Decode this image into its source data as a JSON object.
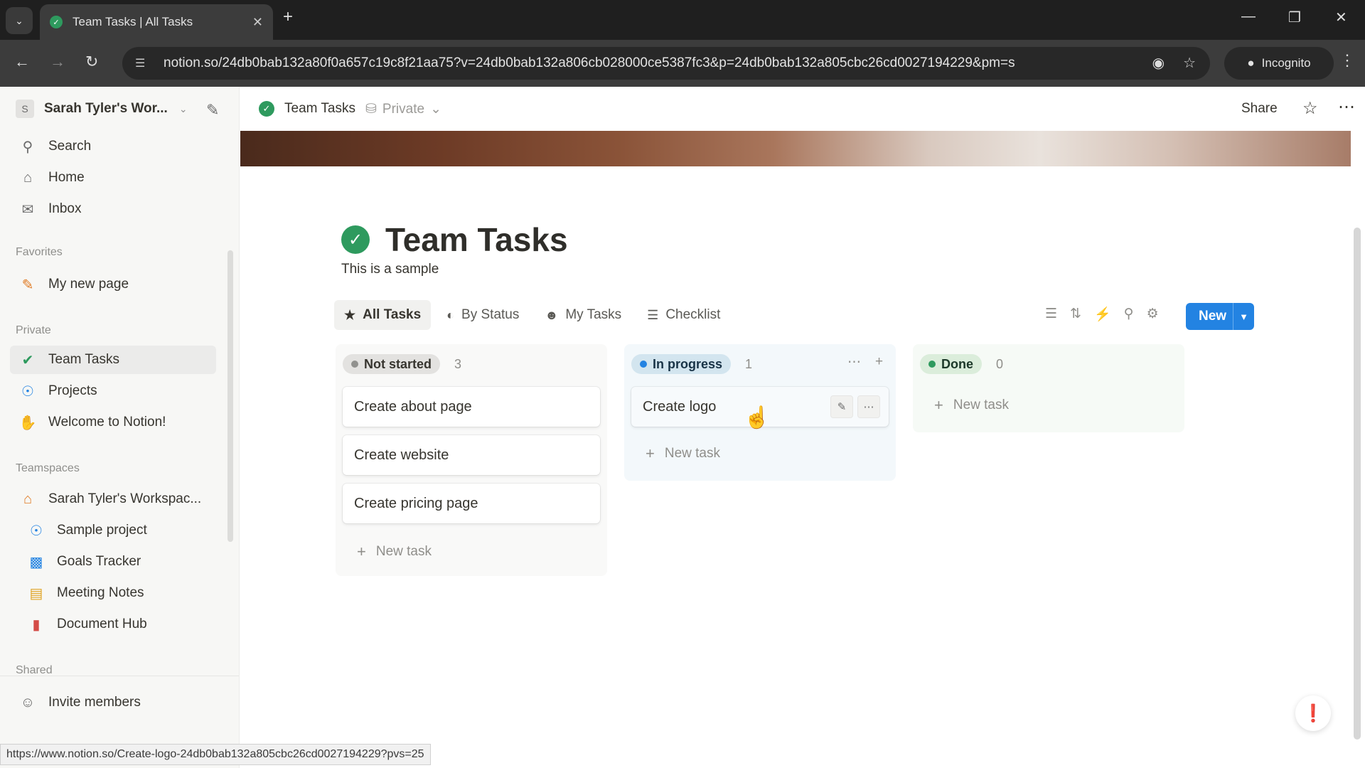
{
  "browser": {
    "tab_title": "Team Tasks | All Tasks",
    "url": "notion.so/24db0bab132a80f0a657c19c8f21aa75?v=24db0bab132a806cb028000ce5387fc3&p=24db0bab132a805cbc26cd0027194229&pm=s",
    "incognito_label": "Incognito",
    "status_url": "https://www.notion.so/Create-logo-24db0bab132a805cbc26cd0027194229?pvs=25"
  },
  "sidebar": {
    "workspace_initial": "S",
    "workspace_name": "Sarah Tyler's Wor...",
    "top_items": [
      {
        "label": "Search",
        "icon": "search-icon"
      },
      {
        "label": "Home",
        "icon": "home-icon"
      },
      {
        "label": "Inbox",
        "icon": "inbox-icon"
      }
    ],
    "favorites_heading": "Favorites",
    "favorites": [
      {
        "label": "My new page",
        "icon": "pencil-icon"
      }
    ],
    "private_heading": "Private",
    "private_items": [
      {
        "label": "Team Tasks",
        "icon": "check-circle-icon"
      },
      {
        "label": "Projects",
        "icon": "projects-icon"
      },
      {
        "label": "Welcome to Notion!",
        "icon": "wave-icon"
      }
    ],
    "teamspaces_heading": "Teamspaces",
    "teamspace_name": "Sarah Tyler's Workspac...",
    "teamspace_items": [
      {
        "label": "Sample project",
        "icon": "projects-icon"
      },
      {
        "label": "Goals Tracker",
        "icon": "chart-icon"
      },
      {
        "label": "Meeting Notes",
        "icon": "calendar-icon"
      },
      {
        "label": "Document Hub",
        "icon": "document-icon"
      }
    ],
    "shared_heading": "Shared",
    "invite_label": "Invite members"
  },
  "topbar": {
    "crumb": "Team Tasks",
    "privacy": "Private",
    "share": "Share"
  },
  "page": {
    "title": "Team Tasks",
    "description": "This is a sample",
    "views": [
      {
        "label": "All Tasks",
        "icon": "star-icon",
        "active": true
      },
      {
        "label": "By Status",
        "icon": "status-icon",
        "active": false
      },
      {
        "label": "My Tasks",
        "icon": "person-icon",
        "active": false
      },
      {
        "label": "Checklist",
        "icon": "checklist-icon",
        "active": false
      }
    ],
    "new_button": "New"
  },
  "board": {
    "new_task_label": "New task",
    "columns": [
      {
        "status": "Not started",
        "count": "3",
        "color": "#91918e",
        "bg": "#e3e2e0",
        "tasks": [
          "Create about page",
          "Create website",
          "Create pricing page"
        ]
      },
      {
        "status": "In progress",
        "count": "1",
        "color": "#2383e2",
        "bg": "#d3e5ef",
        "tasks": [
          "Create logo"
        ]
      },
      {
        "status": "Done",
        "count": "0",
        "color": "#2e9a5e",
        "bg": "#dbeddb",
        "tasks": []
      }
    ]
  }
}
